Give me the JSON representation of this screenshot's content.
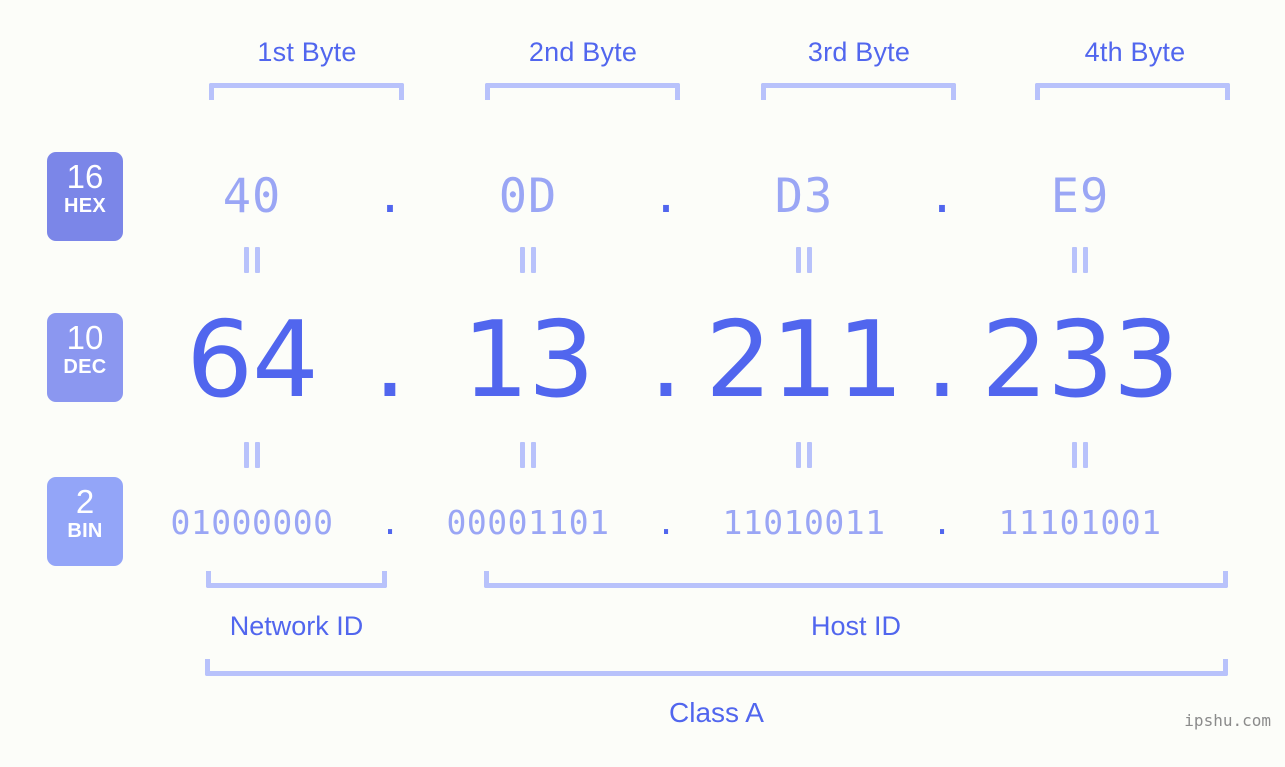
{
  "background_color": "#fcfdf9",
  "accent_color": "#5166ee",
  "light_accent_color": "#9aa6f5",
  "bracket_color": "#b8c2fb",
  "byte_headers": [
    {
      "label": "1st Byte"
    },
    {
      "label": "2nd Byte"
    },
    {
      "label": "3rd Byte"
    },
    {
      "label": "4th Byte"
    }
  ],
  "bases": [
    {
      "number": "16",
      "name": "HEX",
      "color": "#7b86e8"
    },
    {
      "number": "10",
      "name": "DEC",
      "color": "#8b97f0"
    },
    {
      "number": "2",
      "name": "BIN",
      "color": "#93a5f8"
    }
  ],
  "separator": ".",
  "equals_symbol": "=",
  "rows": {
    "hex": {
      "values": [
        "40",
        "0D",
        "D3",
        "E9"
      ]
    },
    "dec": {
      "values": [
        "64",
        "13",
        "211",
        "233"
      ]
    },
    "bin": {
      "values": [
        "01000000",
        "00001101",
        "11010011",
        "11101001"
      ]
    }
  },
  "footer": {
    "network_id_label": "Network ID",
    "host_id_label": "Host ID",
    "class_label": "Class A"
  },
  "watermark": "ipshu.com"
}
